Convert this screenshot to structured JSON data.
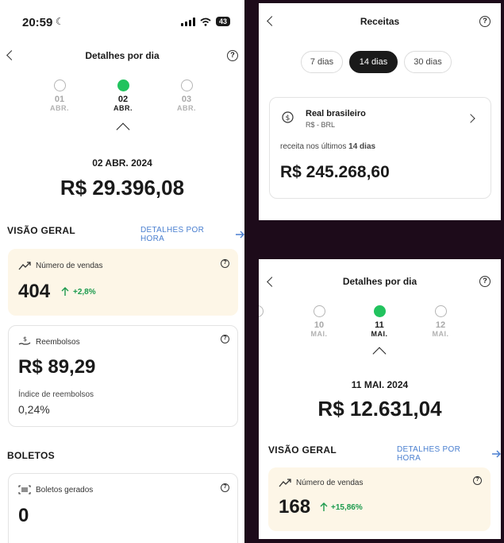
{
  "left": {
    "status": {
      "time": "20:59",
      "battery": "43"
    },
    "nav": {
      "title": "Detalhes por dia"
    },
    "days": [
      {
        "num": "01",
        "mon": "ABR."
      },
      {
        "num": "02",
        "mon": "ABR."
      },
      {
        "num": "03",
        "mon": "ABR."
      }
    ],
    "selected_date": "02 ABR. 2024",
    "total": "R$ 29.396,08",
    "overview": {
      "title": "VISÃO GERAL",
      "link": "DETALHES POR HORA"
    },
    "sales": {
      "label": "Número de vendas",
      "value": "404",
      "delta": "+2,8%"
    },
    "refunds": {
      "label": "Reembolsos",
      "value": "R$ 89,29",
      "rate_label": "Índice de reembolsos",
      "rate_value": "0,24%"
    },
    "boletos": {
      "title": "BOLETOS",
      "label": "Boletos gerados",
      "value": "0"
    }
  },
  "top_right": {
    "nav": {
      "title": "Receitas"
    },
    "periods": [
      "7 dias",
      "14 dias",
      "30 dias"
    ],
    "active_period": "14 dias",
    "currency": {
      "name": "Real brasileiro",
      "code": "R$ - BRL"
    },
    "revenue_prefix": "receita nos últimos",
    "revenue_period": "14 dias",
    "revenue_value": "R$ 245.268,60"
  },
  "bottom_right": {
    "nav": {
      "title": "Detalhes por dia"
    },
    "days": [
      {
        "num": "10",
        "mon": "MAI."
      },
      {
        "num": "11",
        "mon": "MAI."
      },
      {
        "num": "12",
        "mon": "MAI."
      }
    ],
    "selected_date": "11 MAI. 2024",
    "total": "R$ 12.631,04",
    "overview": {
      "title": "VISÃO GERAL",
      "link": "DETALHES POR HORA"
    },
    "sales": {
      "label": "Número de vendas",
      "value": "168",
      "delta": "+15,86%"
    }
  },
  "colors": {
    "accent_green": "#22c35e",
    "link_blue": "#4a7fd0",
    "beige_card": "#fdf6e7",
    "positive": "#1c9a4d"
  },
  "icons": [
    "moon-icon",
    "signal-icon",
    "wifi-icon",
    "battery-icon",
    "back-icon",
    "help-icon",
    "trend-icon",
    "refund-icon",
    "barcode-icon",
    "currency-icon",
    "arrow-up-icon",
    "arrow-right-icon",
    "chevron-right-icon"
  ]
}
